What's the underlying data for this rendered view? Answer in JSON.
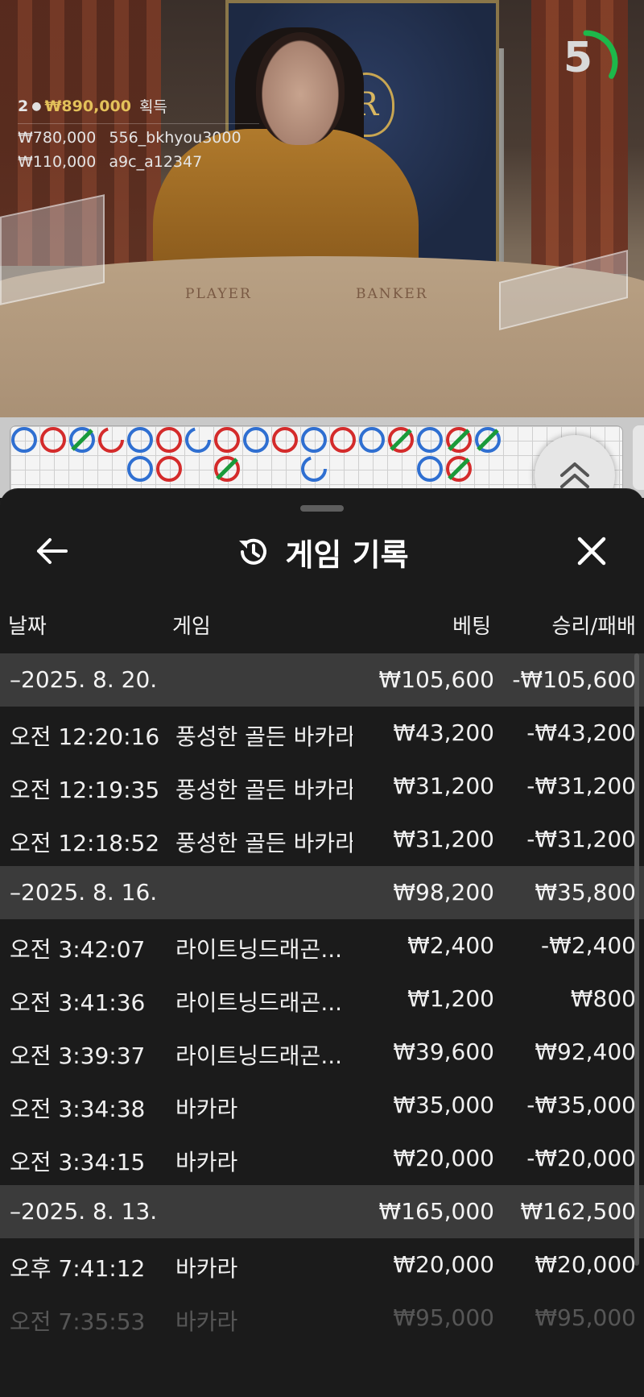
{
  "stream": {
    "winners": {
      "count": "2",
      "total": "₩890,000",
      "suffix": "획득",
      "entries": [
        {
          "amount": "₩780,000",
          "user": "556_bkhyou3000"
        },
        {
          "amount": "₩110,000",
          "user": "a9c_a12347"
        }
      ]
    },
    "countdown": "5",
    "countdown_fraction": 0.33,
    "table_labels": {
      "player": "PLAYER",
      "banker": "BANKER"
    },
    "crest_letter": "R",
    "colors": {
      "player": "#2f6fd1",
      "banker": "#d42b2b",
      "tie": "#1a9a3a",
      "winner_gold": "#e3c15a",
      "timer_green": "#1db84a"
    }
  },
  "history": {
    "title": "게임 기록",
    "icons": {
      "back": "arrow-left-icon",
      "title": "history-clock-icon",
      "close": "close-icon",
      "expand": "chevron-double-up-icon"
    },
    "columns": {
      "date": "날짜",
      "game": "게임",
      "bet": "베팅",
      "result": "승리/패배"
    },
    "groups": [
      {
        "date": "–2025. 8. 20.",
        "bet": "₩105,600",
        "result": "-₩105,600",
        "rows": [
          {
            "time": "오전 12:20:16",
            "game": "풍성한 골든 바카라",
            "bet": "₩43,200",
            "result": "-₩43,200"
          },
          {
            "time": "오전 12:19:35",
            "game": "풍성한 골든 바카라",
            "bet": "₩31,200",
            "result": "-₩31,200"
          },
          {
            "time": "오전 12:18:52",
            "game": "풍성한 골든 바카라",
            "bet": "₩31,200",
            "result": "-₩31,200"
          }
        ]
      },
      {
        "date": "–2025. 8. 16.",
        "bet": "₩98,200",
        "result": "₩35,800",
        "rows": [
          {
            "time": "오전 3:42:07",
            "game": "라이트닝드래곤...",
            "bet": "₩2,400",
            "result": "-₩2,400"
          },
          {
            "time": "오전 3:41:36",
            "game": "라이트닝드래곤...",
            "bet": "₩1,200",
            "result": "₩800"
          },
          {
            "time": "오전 3:39:37",
            "game": "라이트닝드래곤...",
            "bet": "₩39,600",
            "result": "₩92,400"
          },
          {
            "time": "오전 3:34:38",
            "game": "바카라",
            "bet": "₩35,000",
            "result": "-₩35,000"
          },
          {
            "time": "오전 3:34:15",
            "game": "바카라",
            "bet": "₩20,000",
            "result": "-₩20,000"
          }
        ]
      },
      {
        "date": "–2025. 8. 13.",
        "bet": "₩165,000",
        "result": "₩162,500",
        "rows": [
          {
            "time": "오후 7:41:12",
            "game": "바카라",
            "bet": "₩20,000",
            "result": "₩20,000"
          },
          {
            "time": "오전 7:35:53",
            "game": "바카라",
            "bet": "₩95,000",
            "result": "₩95,000"
          }
        ]
      }
    ]
  },
  "roadmap": {
    "top_row": [
      "P",
      "B",
      "PT",
      "BH",
      "P",
      "B",
      "PH",
      "B",
      "P",
      "B",
      "P",
      "B",
      "P",
      "BT",
      "P",
      "BT",
      "PT"
    ],
    "second_row": [
      null,
      null,
      null,
      null,
      "P",
      "B",
      null,
      "BT",
      null,
      null,
      "PH",
      null,
      null,
      null,
      "P",
      "BT",
      null
    ]
  }
}
